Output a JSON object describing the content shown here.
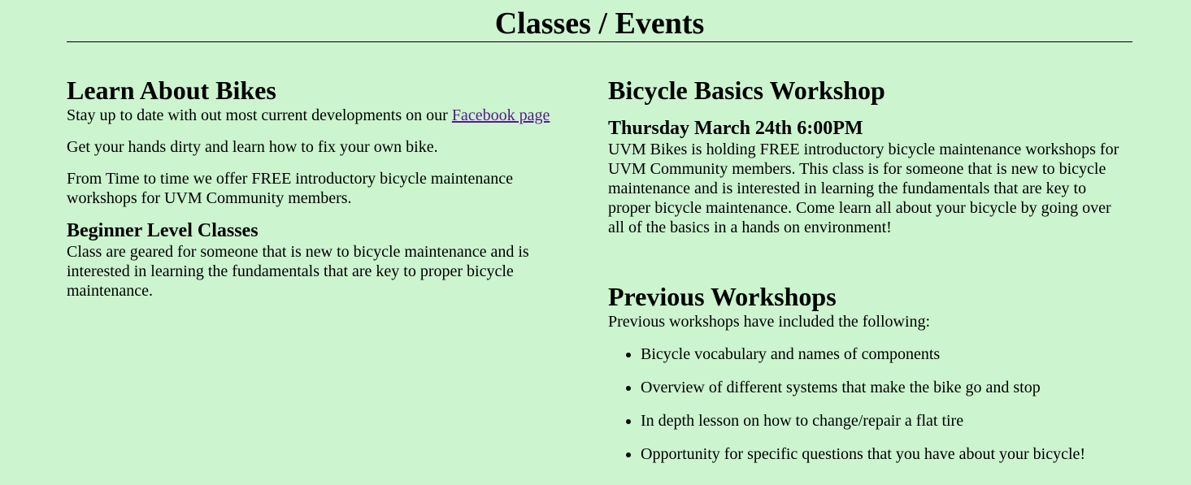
{
  "page": {
    "title": "Classes / Events"
  },
  "left": {
    "heading": "Learn About Bikes",
    "intro_text": "Stay up to date with out most current developments on our ",
    "facebook_link": "Facebook page",
    "para_hands": "Get your hands dirty and learn how to fix your own bike.",
    "para_offer": "From Time to time we offer FREE introductory bicycle maintenance workshops for UVM Community members.",
    "beginner_heading": "Beginner Level Classes",
    "beginner_text": "Class are geared for someone that is new to bicycle maintenance and is interested in learning the fundamentals that are key to proper bicycle maintenance."
  },
  "right": {
    "workshop_heading": "Bicycle Basics Workshop",
    "workshop_date": "Thursday March 24th 6:00PM",
    "workshop_text": "UVM Bikes is holding FREE introductory bicycle maintenance workshops for UVM Community members. This class is for someone that is new to bicycle maintenance and is interested in learning the fundamentals that are key to proper bicycle maintenance. Come learn all about your bicycle by going over all of the basics in a hands on environment!",
    "previous_heading": "Previous Workshops",
    "previous_intro": "Previous workshops have included the following:",
    "previous_items": [
      "Bicycle vocabulary and names of components",
      "Overview of different systems that make the bike go and stop",
      "In depth lesson on how to change/repair a flat tire",
      "Opportunity for specific questions that you have about your bicycle!"
    ]
  }
}
